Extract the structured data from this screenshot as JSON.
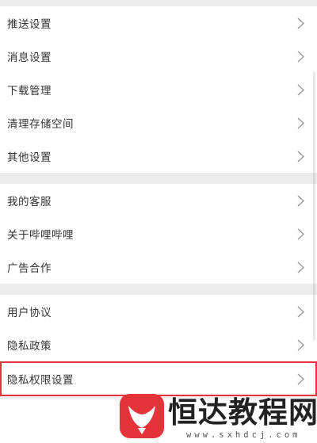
{
  "settings": {
    "group1": [
      {
        "label": "推送设置"
      },
      {
        "label": "消息设置"
      },
      {
        "label": "下载管理"
      },
      {
        "label": "清理存储空间"
      },
      {
        "label": "其他设置"
      }
    ],
    "group2": [
      {
        "label": "我的客服"
      },
      {
        "label": "关于哔哩哔哩"
      },
      {
        "label": "广告合作"
      }
    ],
    "group3": [
      {
        "label": "用户协议"
      },
      {
        "label": "隐私政策"
      },
      {
        "label": "隐私权限设置"
      }
    ]
  },
  "watermark": {
    "brand": "恒达教程网",
    "url": "www.sxhdcj.com"
  },
  "colors": {
    "highlight": "#e4343a",
    "logo": "#e4343a"
  },
  "icons": {
    "row_arrow": "chevron-right-icon"
  }
}
